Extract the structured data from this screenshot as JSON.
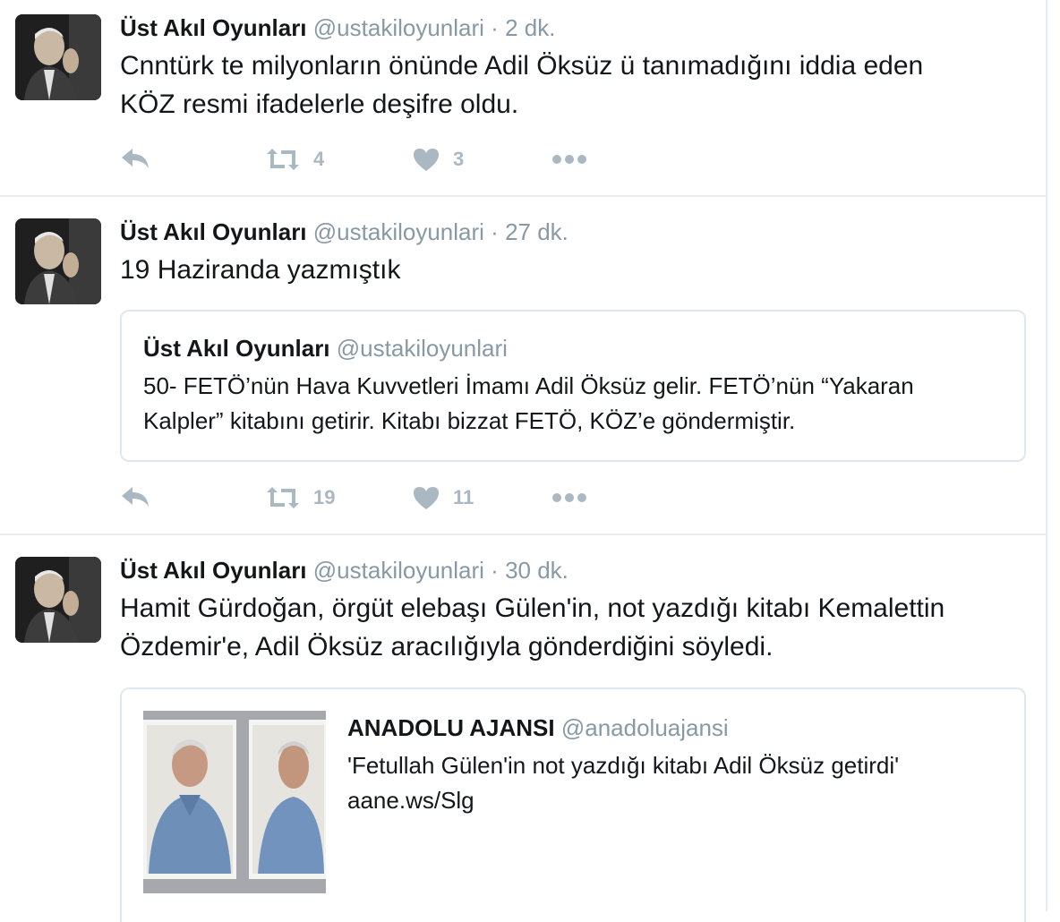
{
  "tweets": [
    {
      "name": "Üst Akıl Oyunları",
      "handle": "@ustakiloyunlari",
      "dot": "·",
      "time": "2 dk.",
      "text_lines": [
        "Cnntürk te milyonların önünde Adil Öksüz ü tanımadığını iddia eden",
        "KÖZ resmi ifadelerle deşifre oldu."
      ],
      "retweets": "4",
      "likes": "3"
    },
    {
      "name": "Üst Akıl Oyunları",
      "handle": "@ustakiloyunlari",
      "dot": "·",
      "time": "27 dk.",
      "text_lines": [
        "19 Haziranda yazmıştık"
      ],
      "quote": {
        "name": "Üst Akıl Oyunları",
        "handle": "@ustakiloyunlari",
        "text_lines": [
          "50- FETÖ’nün Hava Kuvvetleri İmamı Adil Öksüz gelir. FETÖ’nün “Yakaran",
          "Kalpler” kitabını getirir. Kitabı bizzat FETÖ, KÖZ’e göndermiştir."
        ]
      },
      "retweets": "19",
      "likes": "11"
    },
    {
      "name": "Üst Akıl Oyunları",
      "handle": "@ustakiloyunlari",
      "dot": "·",
      "time": "30 dk.",
      "text_lines": [
        "Hamit Gürdoğan, örgüt elebaşı Gülen'in, not yazdığı kitabı Kemalettin",
        "Özdemir'e,  Adil Öksüz aracılığıyla gönderdiğini söyledi."
      ],
      "card": {
        "name": "ANADOLU AJANSI",
        "handle": "@anadoluajansi",
        "title": "'Fetullah Gülen'in not yazdığı kitabı Adil Öksüz getirdi'",
        "link": "aane.ws/Slg"
      }
    }
  ],
  "icons": {
    "reply": "reply-icon",
    "retweet": "retweet-icon",
    "like": "heart-icon",
    "more": "more-icon"
  },
  "colors": {
    "name": "#14171a",
    "secondary": "#8899a6",
    "action": "#aab8c2",
    "border": "#e6ecf0"
  }
}
